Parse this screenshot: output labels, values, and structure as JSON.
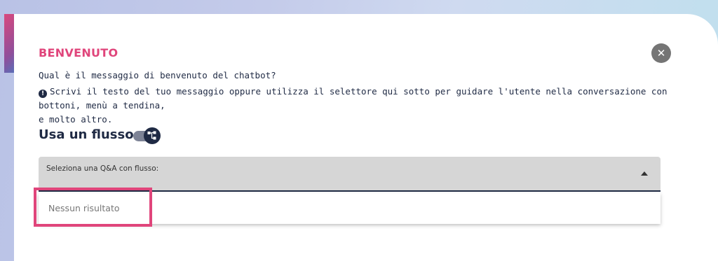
{
  "dialog": {
    "title": "BENVENUTO",
    "close_icon": "close-icon",
    "question": "Qual è il messaggio di benvenuto del chatbot?",
    "hint_icon": "info-icon",
    "hint_line1": "Scrivi il testo del tuo messaggio oppure utilizza il selettore qui sotto per guidare l'utente nella conversazione con bottoni, menù a tendina,",
    "hint_line2": "e molto altro.",
    "flow_section": {
      "title": "Usa un flusso",
      "toggle_state": "on",
      "toggle_icon": "flow-icon"
    },
    "select": {
      "label": "Seleziona una Q&A con flusso:",
      "arrow_icon": "caret-up-icon",
      "state": "open"
    },
    "dropdown": {
      "no_results_text": "Nessun risultato"
    }
  },
  "colors": {
    "title_accent": "#e0457b",
    "text_dark": "#1f2a44",
    "close_button_bg": "#757575",
    "select_bg": "#d6d6d6",
    "highlight": "#e0457b"
  }
}
